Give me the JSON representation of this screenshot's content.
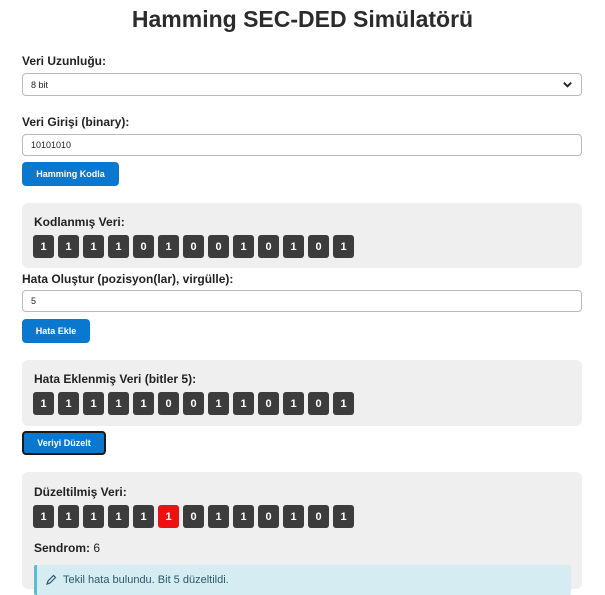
{
  "title": "Hamming SEC-DED Simülatörü",
  "length": {
    "label": "Veri Uzunluğu:",
    "value": "8 bit"
  },
  "data_input": {
    "label": "Veri Girişi (binary):",
    "value": "10101010"
  },
  "encode_button": "Hamming Kodla",
  "encoded": {
    "label": "Kodlanmış Veri:",
    "bits": [
      "1",
      "1",
      "1",
      "1",
      "0",
      "1",
      "0",
      "0",
      "1",
      "0",
      "1",
      "0",
      "1"
    ]
  },
  "error_input": {
    "label": "Hata Oluştur (pozisyon(lar), virgülle):",
    "value": "5"
  },
  "add_error_button": "Hata Ekle",
  "erroneous": {
    "label": "Hata Eklenmiş Veri (bitler 5):",
    "bits": [
      "1",
      "1",
      "1",
      "1",
      "1",
      "0",
      "0",
      "1",
      "1",
      "0",
      "1",
      "0",
      "1"
    ]
  },
  "correct_button": "Veriyi Düzelt",
  "corrected": {
    "label": "Düzeltilmiş Veri:",
    "bits": [
      "1",
      "1",
      "1",
      "1",
      "1",
      "1",
      "0",
      "1",
      "1",
      "0",
      "1",
      "0",
      "1"
    ],
    "highlight_index": 5,
    "highlight_color": "#ee1111"
  },
  "syndrome": {
    "label": "Sendrom:",
    "value": "6"
  },
  "result_message": "Tekil hata bulundu. Bit 5 düzeltildi.",
  "icons": {
    "message_icon": "pencil-icon",
    "select_icon": "chevron-down-icon"
  }
}
